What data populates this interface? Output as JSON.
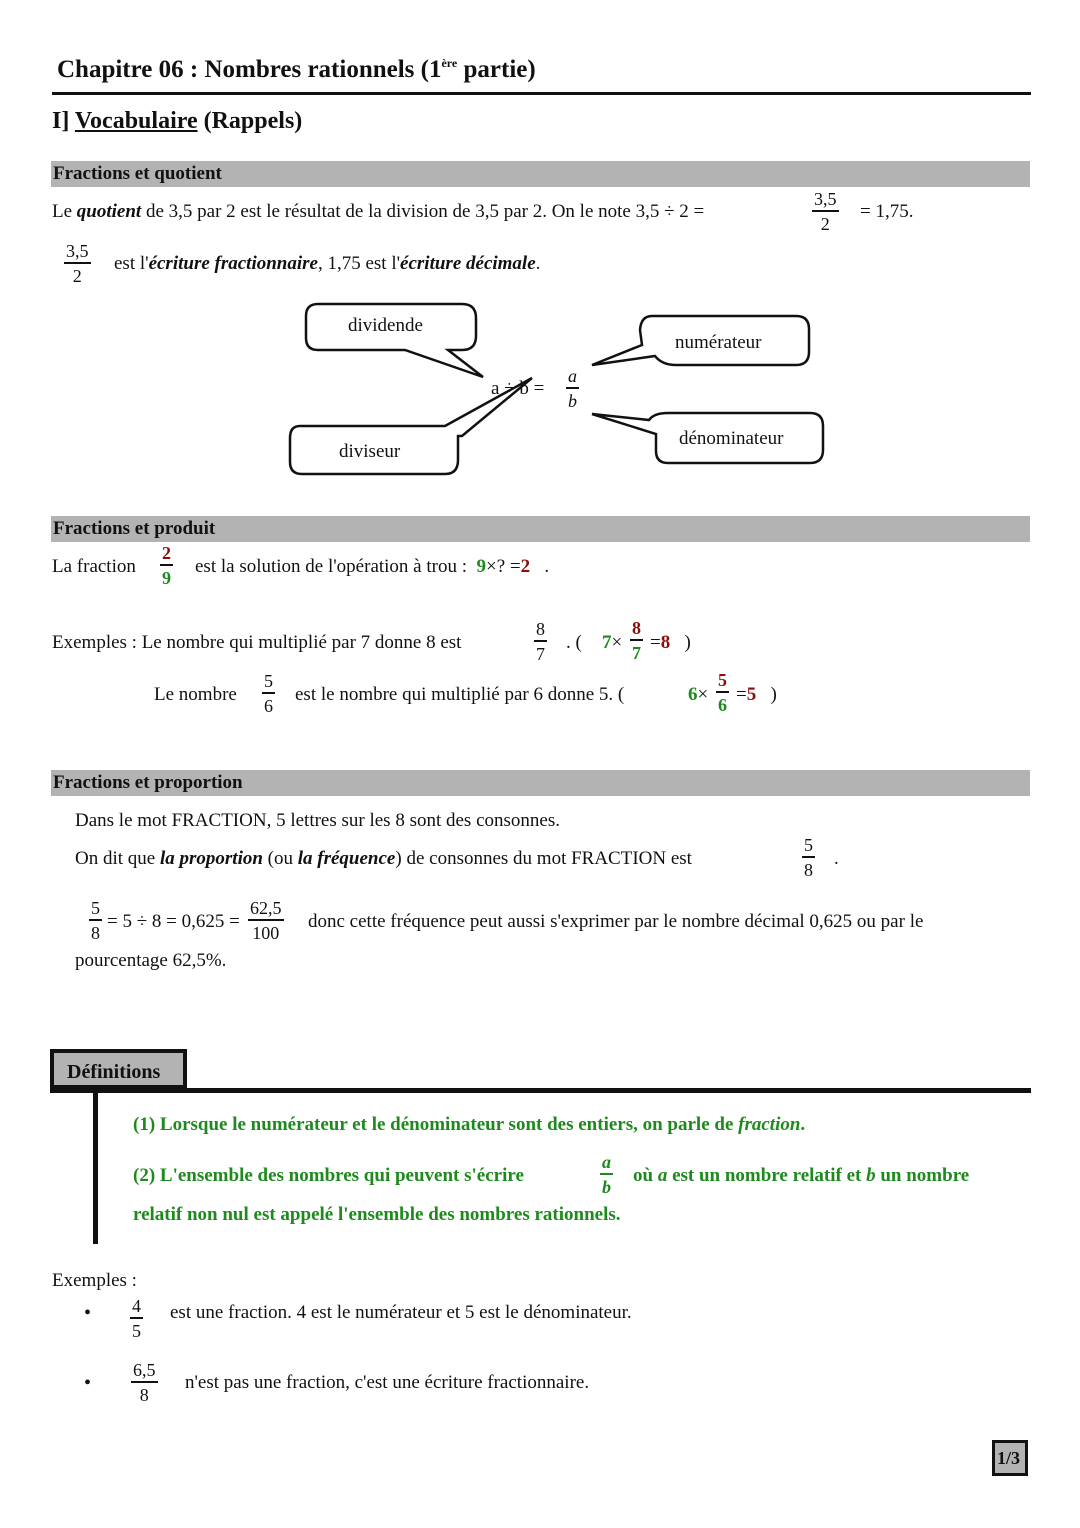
{
  "header": {
    "title_prefix": "Chapitre 06 : Nombres rationnels (1",
    "title_sup": "ère",
    "title_suffix": " partie)"
  },
  "section1": {
    "number": "I]",
    "title": "Vocabulaire",
    "subtitle": "(Rappels)"
  },
  "quotient": {
    "band": "Fractions et quotient",
    "line1_a": "Le ",
    "line1_b": "quotient",
    "line1_c": " de 3,5 par 2 est le résultat de la division de 3,5 par 2. On le note 3,5 ÷ 2 =",
    "line1_frac_num": "3,5",
    "line1_frac_den": "2",
    "line1_d": "= 1,75.",
    "line2_frac_num": "3,5",
    "line2_frac_den": "2",
    "line2_a": "est l'",
    "line2_b": "écriture fractionnaire",
    "line2_c": ", 1,75 est l'",
    "line2_d": "écriture décimale",
    "line2_e": ".",
    "diagram": {
      "expr": "a ÷ b =",
      "num": "a",
      "den": "b",
      "bubbles": {
        "dividend": "dividende",
        "divisor": "diviseur",
        "numerator": "numérateur",
        "denominator": "dénominateur"
      }
    }
  },
  "produit": {
    "band": "Fractions et produit",
    "line1_a": "La fraction",
    "frac_num": "2",
    "frac_den": "9",
    "line1_b": "est la solution de l'opération à trou :",
    "op_a": "9",
    "op_b": "×? =",
    "op_c": "2",
    "op_end": ".",
    "ex1_a": "Exemples : Le nombre qui multiplié par 7 donne 8 est",
    "ex1_num": "8",
    "ex1_den": "7",
    "ex1_b": ". (",
    "ex1_m": "7",
    "ex1_x": "×",
    "ex1_fnum": "8",
    "ex1_fden": "7",
    "ex1_eq": "=",
    "ex1_r": "8",
    "ex1_close": ")",
    "ex2_a": "Le nombre",
    "ex2_num": "5",
    "ex2_den": "6",
    "ex2_b": "est le nombre qui multiplié par 6 donne 5. (",
    "ex2_m": "6",
    "ex2_x": "×",
    "ex2_fnum": "5",
    "ex2_fden": "6",
    "ex2_eq": "=",
    "ex2_r": "5",
    "ex2_close": ")"
  },
  "proportion": {
    "band": "Fractions et proportion",
    "line1": "Dans le mot FRACTION, 5 lettres sur les 8 sont des consonnes.",
    "line2_a": "On dit que ",
    "line2_b": "la proportion",
    "line2_c": " (ou ",
    "line2_d": "la fréquence",
    "line2_e": ") de consonnes du mot FRACTION est",
    "line2_num": "5",
    "line2_den": "8",
    "line2_end": ".",
    "eq_num1": "5",
    "eq_den1": "8",
    "eq_mid": "= 5 ÷ 8 = 0,625 =",
    "eq_num2": "62,5",
    "eq_den2": "100",
    "line3": "donc cette fréquence peut aussi s'exprimer par le nombre décimal 0,625 ou par le",
    "line4": "pourcentage 62,5%."
  },
  "definitions": {
    "tab": "Définitions",
    "def1_a": "(1)  Lorsque le numérateur et le dénominateur sont des entiers, on parle de ",
    "def1_b": "fraction",
    "def1_c": ".",
    "def2_a": "(2)  L'ensemble des nombres qui peuvent s'écrire",
    "def2_num": "a",
    "def2_den": "b",
    "def2_b": "où ",
    "def2_c": "a",
    "def2_d": " est un nombre relatif et ",
    "def2_e": "b",
    "def2_f": " un nombre",
    "def2_line2": "relatif non nul est appelé l'ensemble des nombres rationnels."
  },
  "examples": {
    "label": "Exemples :",
    "items": [
      {
        "bullet": "•",
        "num": "4",
        "den": "5",
        "text": "est une fraction. 4 est le numérateur et 5 est le dénominateur."
      },
      {
        "bullet": "•",
        "num": "6,5",
        "den": "8",
        "text": "n'est pas une fraction, c'est une écriture fractionnaire."
      }
    ]
  },
  "footer": {
    "page": "1/3"
  }
}
